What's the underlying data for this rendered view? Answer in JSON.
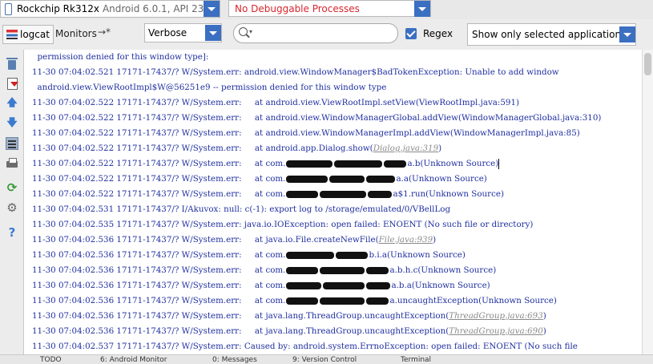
{
  "device_bar": {
    "device_name": "Rockchip Rk312x",
    "device_api": "Android 6.0.1, API 23",
    "process_label": "No Debuggable Processes"
  },
  "toolbar": {
    "logcat_tab": "logcat",
    "monitors_tab": "Monitors",
    "monitors_suffix": "→*",
    "log_level": "Verbose",
    "search_value": "",
    "regex_label": "Regex",
    "regex_checked": true,
    "filter_option": "Show only selected application"
  },
  "side_tools": [
    "trash-icon",
    "scroll-to-end-icon",
    "up-arrow-icon",
    "down-arrow-icon",
    "soft-wrap-icon",
    "print-icon",
    "restart-icon",
    "gear-icon",
    "help-icon"
  ],
  "log": {
    "lines": [
      {
        "head": "  permission denied for this window type]:"
      },
      {
        "head": "11-30 07:04:02.521 17171-17437/? W/System.err: android.view.WindowManager$BadTokenException: Unable to add window"
      },
      {
        "head": "  android.view.ViewRootImpl$W@56251e9 -- permission denied for this window type"
      },
      {
        "head": "11-30 07:04:02.522 17171-17437/? W/System.err:     at android.view.ViewRootImpl.setView(ViewRootImpl.java:591)"
      },
      {
        "head": "11-30 07:04:02.522 17171-17437/? W/System.err:     at android.view.WindowManagerGlobal.addView(WindowManagerGlobal.java:310)"
      },
      {
        "head": "11-30 07:04:02.522 17171-17437/? W/System.err:     at android.view.WindowManagerImpl.addView(WindowManagerImpl.java:85)"
      },
      {
        "head": "11-30 07:04:02.522 17171-17437/? W/System.err:     at android.app.Dialog.show(",
        "link": "Dialog.java:319",
        "tail": ")"
      },
      {
        "head": "11-30 07:04:02.522 17171-17437/? W/System.err:     at com.",
        "tail": "a.b(Unknown Source)"
      },
      {
        "head": "11-30 07:04:02.522 17171-17437/? W/System.err:     at com.",
        "tail": "a.a(Unknown Source)"
      },
      {
        "head": "11-30 07:04:02.522 17171-17437/? W/System.err:     at com.",
        "tail": "a$1.run(Unknown Source)"
      },
      {
        "head": "11-30 07:04:02.531 17171-17437/? I/Akuvox: null: c(-1): export log to /storage/emulated/0/VBellLog"
      },
      {
        "head": "11-30 07:04:02.535 17171-17437/? W/System.err: java.io.IOException: open failed: ENOENT (No such file or directory)"
      },
      {
        "head": "11-30 07:04:02.536 17171-17437/? W/System.err:     at java.io.File.createNewFile(",
        "link": "File.java:939",
        "tail": ")"
      },
      {
        "head": "11-30 07:04:02.536 17171-17437/? W/System.err:     at com.",
        "tail": "b.i.a(Unknown Source)"
      },
      {
        "head": "11-30 07:04:02.536 17171-17437/? W/System.err:     at com.",
        "tail": "a.b.h.c(Unknown Source)"
      },
      {
        "head": "11-30 07:04:02.536 17171-17437/? W/System.err:     at com.",
        "tail": "a.b.a(Unknown Source)"
      },
      {
        "head": "11-30 07:04:02.536 17171-17437/? W/System.err:     at com.",
        "tail": "a.uncaughtException(Unknown Source)"
      },
      {
        "head": "11-30 07:04:02.536 17171-17437/? W/System.err:     at java.lang.ThreadGroup.uncaughtException(",
        "link": "ThreadGroup.java:693",
        "tail": ")"
      },
      {
        "head": "11-30 07:04:02.536 17171-17437/? W/System.err:     at java.lang.ThreadGroup.uncaughtException(",
        "link": "ThreadGroup.java:690",
        "tail": ")"
      },
      {
        "head": "11-30 07:04:02.537 17171-17437/? W/System.err: Caused by: android.system.ErrnoException: open failed: ENOENT (No such file"
      }
    ]
  },
  "bottom_tabs": [
    "TODO",
    "6: Android Monitor",
    "0: Messages",
    "9: Version Control",
    "Terminal"
  ],
  "colors": {
    "log_text": "#1f2fa0",
    "error_label": "#d7262e",
    "accent": "#3b6fc1"
  }
}
